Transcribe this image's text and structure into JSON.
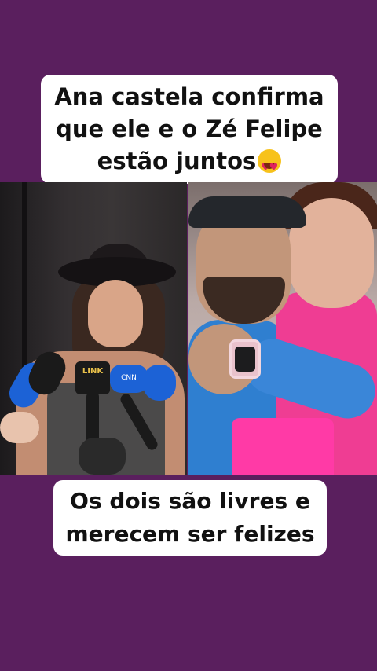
{
  "top_caption": {
    "line1": "Ana castela confirma",
    "line2": "que ele e o Zé Felipe",
    "line3": "estão juntos",
    "emoji_icon": "heart-eyes-emoji"
  },
  "bottom_caption": {
    "line1": "Os dois são livres e",
    "line2": "merecem ser felizes"
  },
  "left_photo": {
    "mic_logo_1": "LINK",
    "mic_logo_2": "CNN"
  },
  "colors": {
    "background": "#5a1f5e",
    "caption_bg": "#ffffff",
    "caption_text": "#111111"
  }
}
